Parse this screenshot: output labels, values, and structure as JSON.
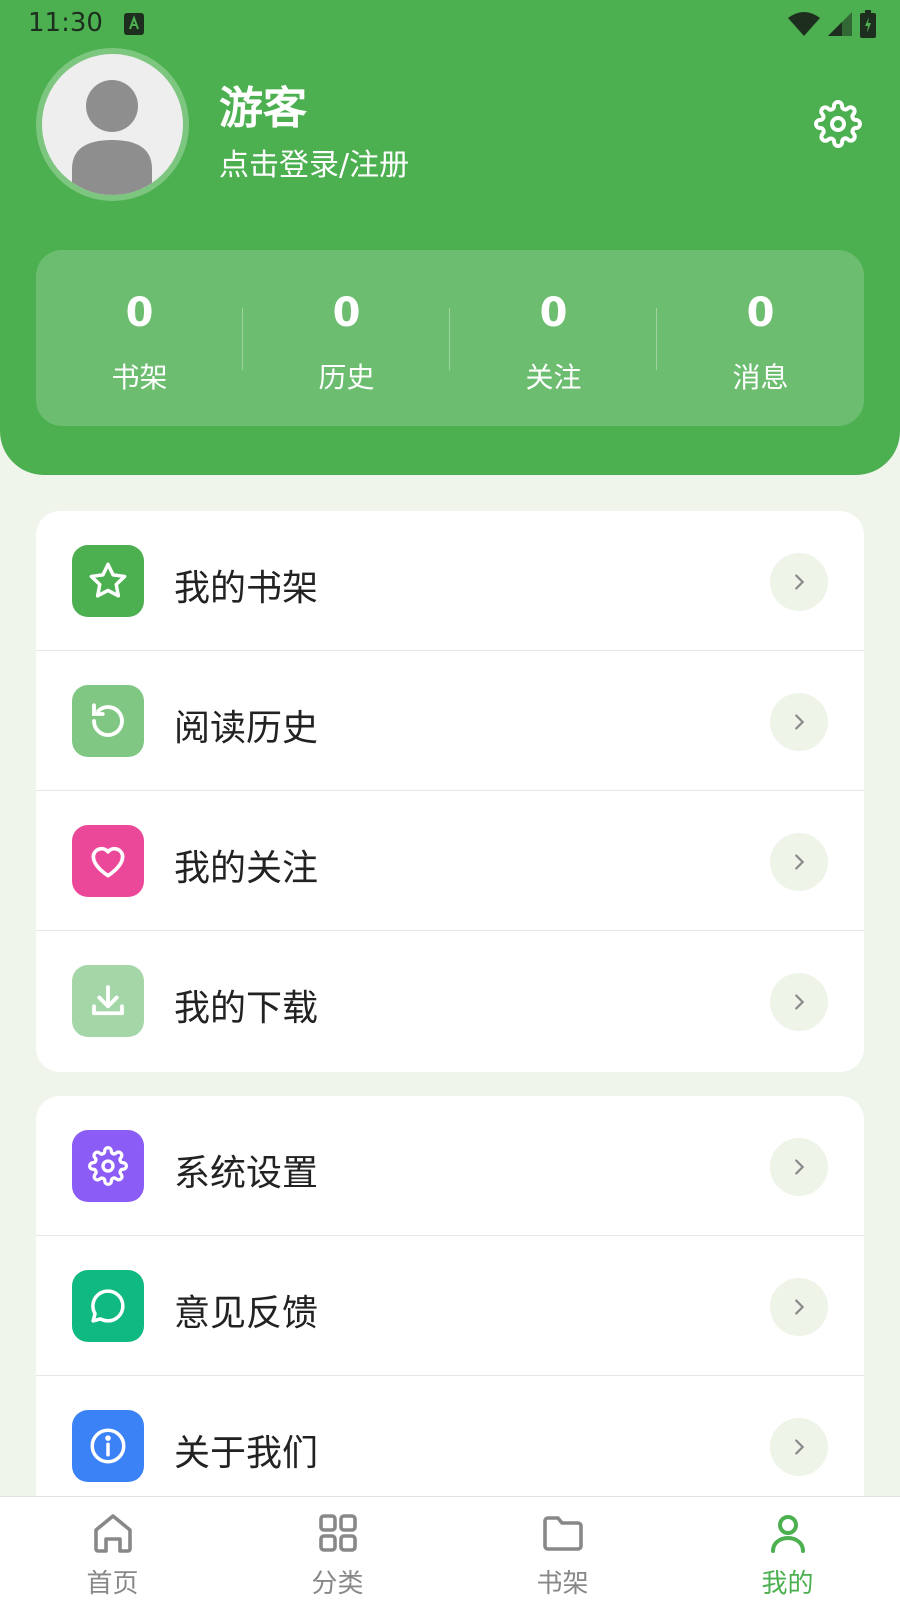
{
  "status_bar": {
    "time": "11:30"
  },
  "profile": {
    "name": "游客",
    "login_prompt": "点击登录/注册"
  },
  "stats": [
    {
      "value": "0",
      "label": "书架"
    },
    {
      "value": "0",
      "label": "历史"
    },
    {
      "value": "0",
      "label": "关注"
    },
    {
      "value": "0",
      "label": "消息"
    }
  ],
  "menu_group_1": [
    {
      "label": "我的书架",
      "icon": "star-icon",
      "color": "#4caf50"
    },
    {
      "label": "阅读历史",
      "icon": "history-icon",
      "color": "#81c784"
    },
    {
      "label": "我的关注",
      "icon": "heart-icon",
      "color": "#ec4899"
    },
    {
      "label": "我的下载",
      "icon": "download-icon",
      "color": "#a5d6a7"
    }
  ],
  "menu_group_2": [
    {
      "label": "系统设置",
      "icon": "gear-icon",
      "color": "#8b5cf6"
    },
    {
      "label": "意见反馈",
      "icon": "chat-icon",
      "color": "#10b981"
    },
    {
      "label": "关于我们",
      "icon": "info-icon",
      "color": "#3b82f6"
    }
  ],
  "tabs": [
    {
      "label": "首页",
      "icon": "home-icon",
      "active": false
    },
    {
      "label": "分类",
      "icon": "grid-icon",
      "active": false
    },
    {
      "label": "书架",
      "icon": "folder-icon",
      "active": false
    },
    {
      "label": "我的",
      "icon": "user-icon",
      "active": true
    }
  ],
  "colors": {
    "primary": "#4caf50",
    "background": "#f0f5eb"
  }
}
